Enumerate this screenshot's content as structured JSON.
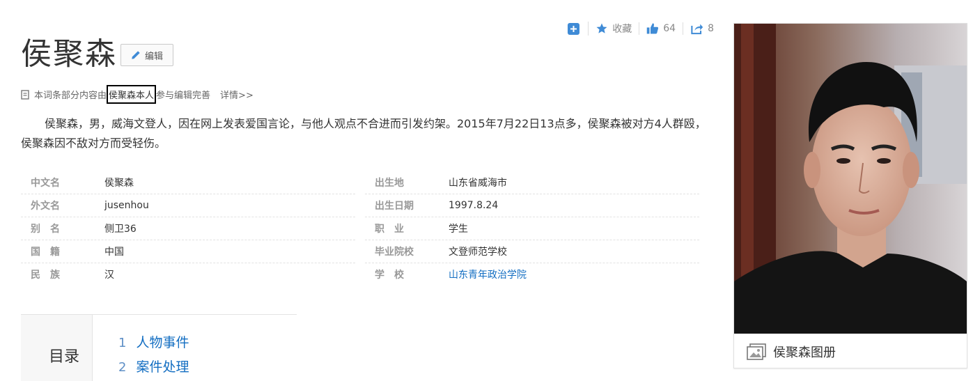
{
  "actions": {
    "favorite_label": "收藏",
    "like_count": "64",
    "share_count": "8"
  },
  "title": "侯聚森",
  "edit_label": "编辑",
  "contrib": {
    "prefix": "本词条部分内容由",
    "person": "侯聚森本人",
    "suffix": "参与编辑完善",
    "detail": "详情>>"
  },
  "summary": "侯聚森，男，威海文登人，因在网上发表爱国言论，与他人观点不合进而引发约架。2015年7月22日13点多，侯聚森被对方4人群殴，侯聚森因不敌对方而受轻伤。",
  "info": {
    "left": [
      {
        "k": "中文名",
        "v": "侯聚森"
      },
      {
        "k": "外文名",
        "v": "jusenhou"
      },
      {
        "k": "别　名",
        "v": "侧卫36"
      },
      {
        "k": "国　籍",
        "v": "中国"
      },
      {
        "k": "民　族",
        "v": "汉"
      }
    ],
    "right": [
      {
        "k": "出生地",
        "v": "山东省威海市"
      },
      {
        "k": "出生日期",
        "v": "1997.8.24"
      },
      {
        "k": "职　业",
        "v": "学生"
      },
      {
        "k": "毕业院校",
        "v": "文登师范学校"
      },
      {
        "k": "学　校",
        "v": "山东青年政治学院"
      }
    ]
  },
  "catalog": {
    "label": "目录",
    "items": [
      {
        "num": "1",
        "text": "人物事件"
      },
      {
        "num": "2",
        "text": "案件处理"
      }
    ]
  },
  "album_label": "侯聚森图册",
  "colors": {
    "accent": "#136ec2",
    "icon_blue": "#3f8bd6"
  }
}
